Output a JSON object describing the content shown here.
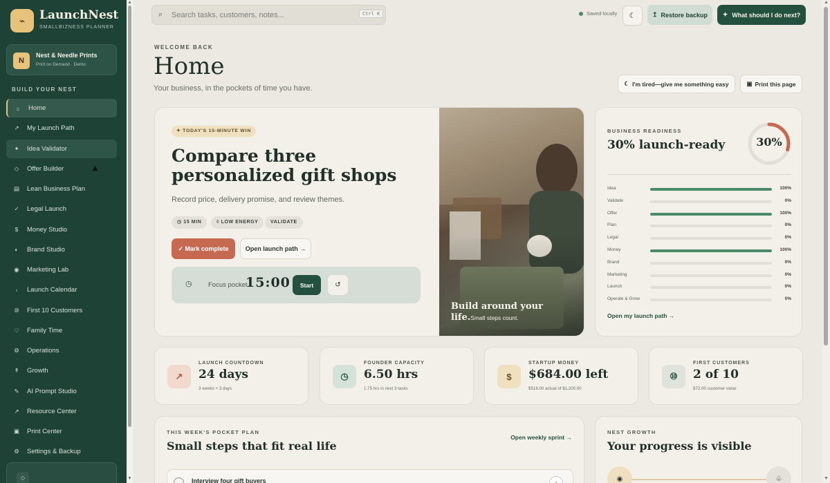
{
  "brand": {
    "name": "LaunchNest",
    "subtitle": "SMALLBIZNESS PLANNER",
    "logo_icon": "leaf-mark"
  },
  "business": {
    "initial": "N",
    "name": "Nest & Needle Prints",
    "sub": "Print on Demand · Demo"
  },
  "nav": {
    "heading": "BUILD YOUR NEST",
    "items": [
      {
        "label": "Home",
        "icon": "⌂"
      },
      {
        "label": "My Launch Path",
        "icon": "↗"
      },
      {
        "label": "Idea Validator",
        "icon": "✦"
      },
      {
        "label": "Offer Builder",
        "icon": "◇"
      },
      {
        "label": "Lean Business Plan",
        "icon": "▤"
      },
      {
        "label": "Legal Launch",
        "icon": "✓"
      },
      {
        "label": "Money Studio",
        "icon": "$"
      },
      {
        "label": "Brand Studio",
        "icon": "◐"
      },
      {
        "label": "Marketing Lab",
        "icon": "◉"
      },
      {
        "label": "Launch Calendar",
        "icon": "▫"
      },
      {
        "label": "First 10 Customers",
        "icon": "⑩"
      },
      {
        "label": "Family Time",
        "icon": "♡"
      },
      {
        "label": "Operations",
        "icon": "⚙"
      },
      {
        "label": "Growth",
        "icon": "↟"
      },
      {
        "label": "AI Prompt Studio",
        "icon": "✎"
      },
      {
        "label": "Resource Center",
        "icon": "↗"
      },
      {
        "label": "Print Center",
        "icon": "▣"
      },
      {
        "label": "Settings & Backup",
        "icon": "⚙"
      }
    ]
  },
  "topbar": {
    "search_placeholder": "Search tasks, customers, notes...",
    "shortcut": "Ctrl K",
    "saved": "Saved locally",
    "restore": "Restore backup",
    "next": "What should I do next?"
  },
  "header": {
    "welcome": "WELCOME BACK",
    "title": "Home",
    "tagline": "Your business, in the pockets of time you have.",
    "tired": "I'm tired—give me something easy",
    "print": "Print this page"
  },
  "hero": {
    "badge": "✦ TODAY'S 15-MINUTE WIN",
    "title": "Compare three personalized gift shops",
    "desc": "Record price, delivery promise, and review themes.",
    "chips": [
      "◷ 15 MIN",
      "◊ LOW ENERGY",
      "VALIDATE"
    ],
    "mark": "✓ Mark complete",
    "open": "Open launch path →",
    "focus_label": "Focus pocket",
    "focus_time": "15:00",
    "start": "Start",
    "photo_title": "Build around your life.",
    "photo_sub": "Small steps count."
  },
  "readiness": {
    "kicker": "BUSINESS READINESS",
    "headline": "30% launch-ready",
    "percent": 30,
    "percent_label": "30%",
    "link": "Open my launch path →",
    "rows": [
      {
        "label": "Idea",
        "value": 100,
        "pct": "100%"
      },
      {
        "label": "Validate",
        "value": 0,
        "pct": "0%"
      },
      {
        "label": "Offer",
        "value": 100,
        "pct": "100%"
      },
      {
        "label": "Plan",
        "value": 0,
        "pct": "0%"
      },
      {
        "label": "Legal",
        "value": 0,
        "pct": "0%"
      },
      {
        "label": "Money",
        "value": 100,
        "pct": "100%"
      },
      {
        "label": "Brand",
        "value": 0,
        "pct": "0%"
      },
      {
        "label": "Marketing",
        "value": 0,
        "pct": "0%"
      },
      {
        "label": "Launch",
        "value": 0,
        "pct": "0%"
      },
      {
        "label": "Operate & Grow",
        "value": 0,
        "pct": "0%"
      }
    ]
  },
  "stats": [
    {
      "kicker": "LAUNCH COUNTDOWN",
      "value": "24 days",
      "sub": "3 weeks + 3 days",
      "icon": "↗",
      "bg": "#f1d9cd",
      "fg": "#b45d43"
    },
    {
      "kicker": "FOUNDER CAPACITY",
      "value": "6.50 hrs",
      "sub": "1.75 hrs in next 3 tasks",
      "icon": "◷",
      "bg": "#d5e2da",
      "fg": "#2f5b49"
    },
    {
      "kicker": "STARTUP MONEY",
      "value": "$684.00 left",
      "sub": "$516.00 actual of $1,200.00",
      "icon": "$",
      "bg": "#efe0bf",
      "fg": "#6b5128"
    },
    {
      "kicker": "FIRST CUSTOMERS",
      "value": "2 of 10",
      "sub": "$72.00 customer value",
      "icon": "⑩",
      "bg": "#dfe3dc",
      "fg": "#2f5b49"
    }
  ],
  "pocket": {
    "kicker": "THIS WEEK'S POCKET PLAN",
    "title": "Small steps that fit real life",
    "link": "Open weekly sprint →",
    "task": "Interview four gift buyers"
  },
  "growth": {
    "kicker": "NEST GROWTH",
    "title": "Your progress is visible"
  }
}
